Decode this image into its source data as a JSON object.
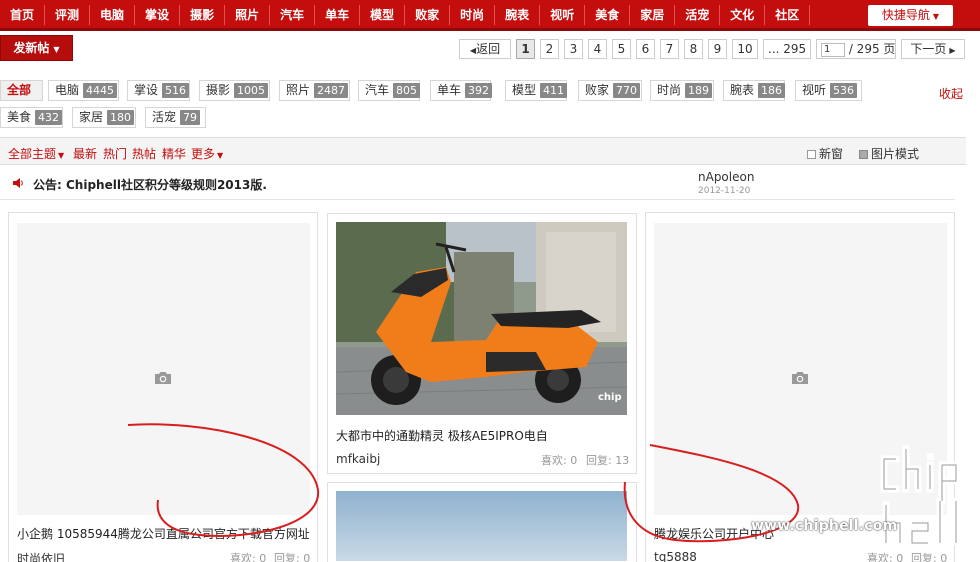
{
  "topnav": {
    "items": [
      "首页",
      "评测",
      "电脑",
      "掌设",
      "摄影",
      "照片",
      "汽车",
      "单车",
      "模型",
      "败家",
      "时尚",
      "腕表",
      "视听",
      "美食",
      "家居",
      "活宠",
      "文化",
      "社区"
    ],
    "quick_nav": "快捷导航"
  },
  "toolbar": {
    "new_post": "发新帖"
  },
  "pager": {
    "back": "返回",
    "pages": [
      "1",
      "2",
      "3",
      "4",
      "5",
      "6",
      "7",
      "8",
      "9",
      "10"
    ],
    "last": "... 295",
    "current_input": "1",
    "total": "/ 295 页",
    "next": "下一页"
  },
  "categories": {
    "items": [
      {
        "name": "全部",
        "count": ""
      },
      {
        "name": "电脑",
        "count": "4445"
      },
      {
        "name": "掌设",
        "count": "516"
      },
      {
        "name": "摄影",
        "count": "1005"
      },
      {
        "name": "照片",
        "count": "2487"
      },
      {
        "name": "汽车",
        "count": "805"
      },
      {
        "name": "单车",
        "count": "392"
      },
      {
        "name": "模型",
        "count": "411"
      },
      {
        "name": "败家",
        "count": "770"
      },
      {
        "name": "时尚",
        "count": "189"
      },
      {
        "name": "腕表",
        "count": "186"
      },
      {
        "name": "视听",
        "count": "536"
      },
      {
        "name": "美食",
        "count": "432"
      },
      {
        "name": "家居",
        "count": "180"
      },
      {
        "name": "活宠",
        "count": "79"
      }
    ],
    "collapse": "收起"
  },
  "filters": {
    "all_topics": "全部主题",
    "latest": "最新",
    "hot": "热门",
    "hot_posts": "热帖",
    "digest": "精华",
    "more": "更多",
    "new_window": "新窗",
    "image_mode": "图片模式"
  },
  "announcement": {
    "label": "公告: Chiphell社区积分等级规则2013版.",
    "author": "nApoleon",
    "date": "2012-11-20"
  },
  "cards": [
    {
      "title": "小企鹅 10585944腾龙公司直属公司官方下载官方网址",
      "user": "时尚依旧",
      "likes": "喜欢: 0",
      "replies": "回复: 0"
    },
    {
      "title": "大都市中的通勤精灵 极核AE5IPRO电自",
      "user": "mfkaibj",
      "likes": "喜欢: 0",
      "replies": "回复: 13"
    },
    {
      "title": "腾龙娱乐公司开户中心",
      "user": "tq5888",
      "likes": "喜欢: 0",
      "replies": "回复: 0"
    }
  ],
  "watermark": {
    "url": "www.chiphell.com"
  },
  "colors": {
    "brand_red": "#c40d0d",
    "dark_red": "#8e0a0a"
  }
}
